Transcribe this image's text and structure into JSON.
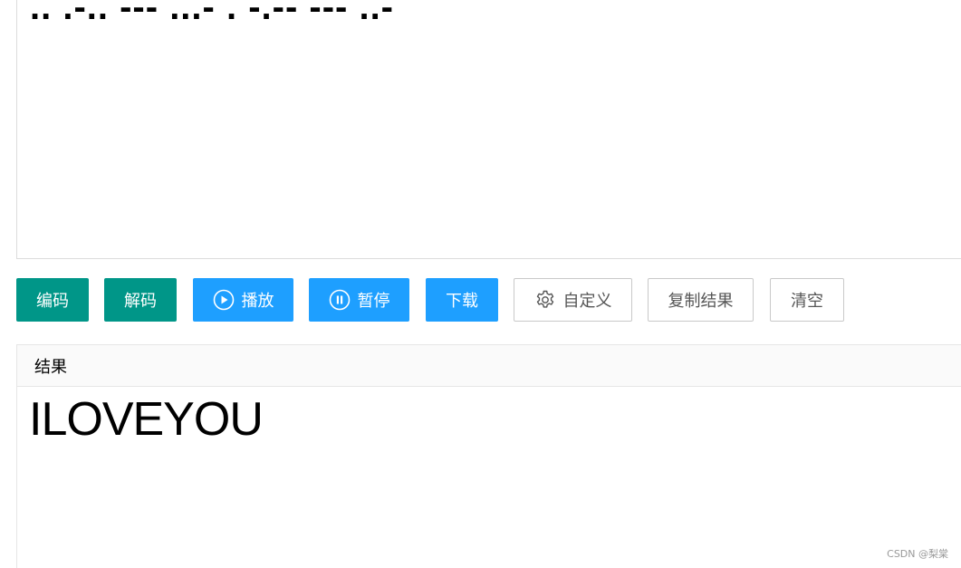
{
  "input": {
    "text": ".. .-.. --- ...- . -.-- --- ..-"
  },
  "toolbar": {
    "encode_label": "编码",
    "decode_label": "解码",
    "play_label": "播放",
    "pause_label": "暂停",
    "download_label": "下载",
    "custom_label": "自定义",
    "copy_label": "复制结果",
    "clear_label": "清空"
  },
  "result": {
    "header": "结果",
    "text": "ILOVEYOU"
  },
  "watermark": "CSDN @梨棠",
  "colors": {
    "green": "#009688",
    "blue": "#1e9fff"
  },
  "icons": {
    "play": "play-circle-icon",
    "pause": "pause-circle-icon",
    "custom": "gear-icon"
  }
}
